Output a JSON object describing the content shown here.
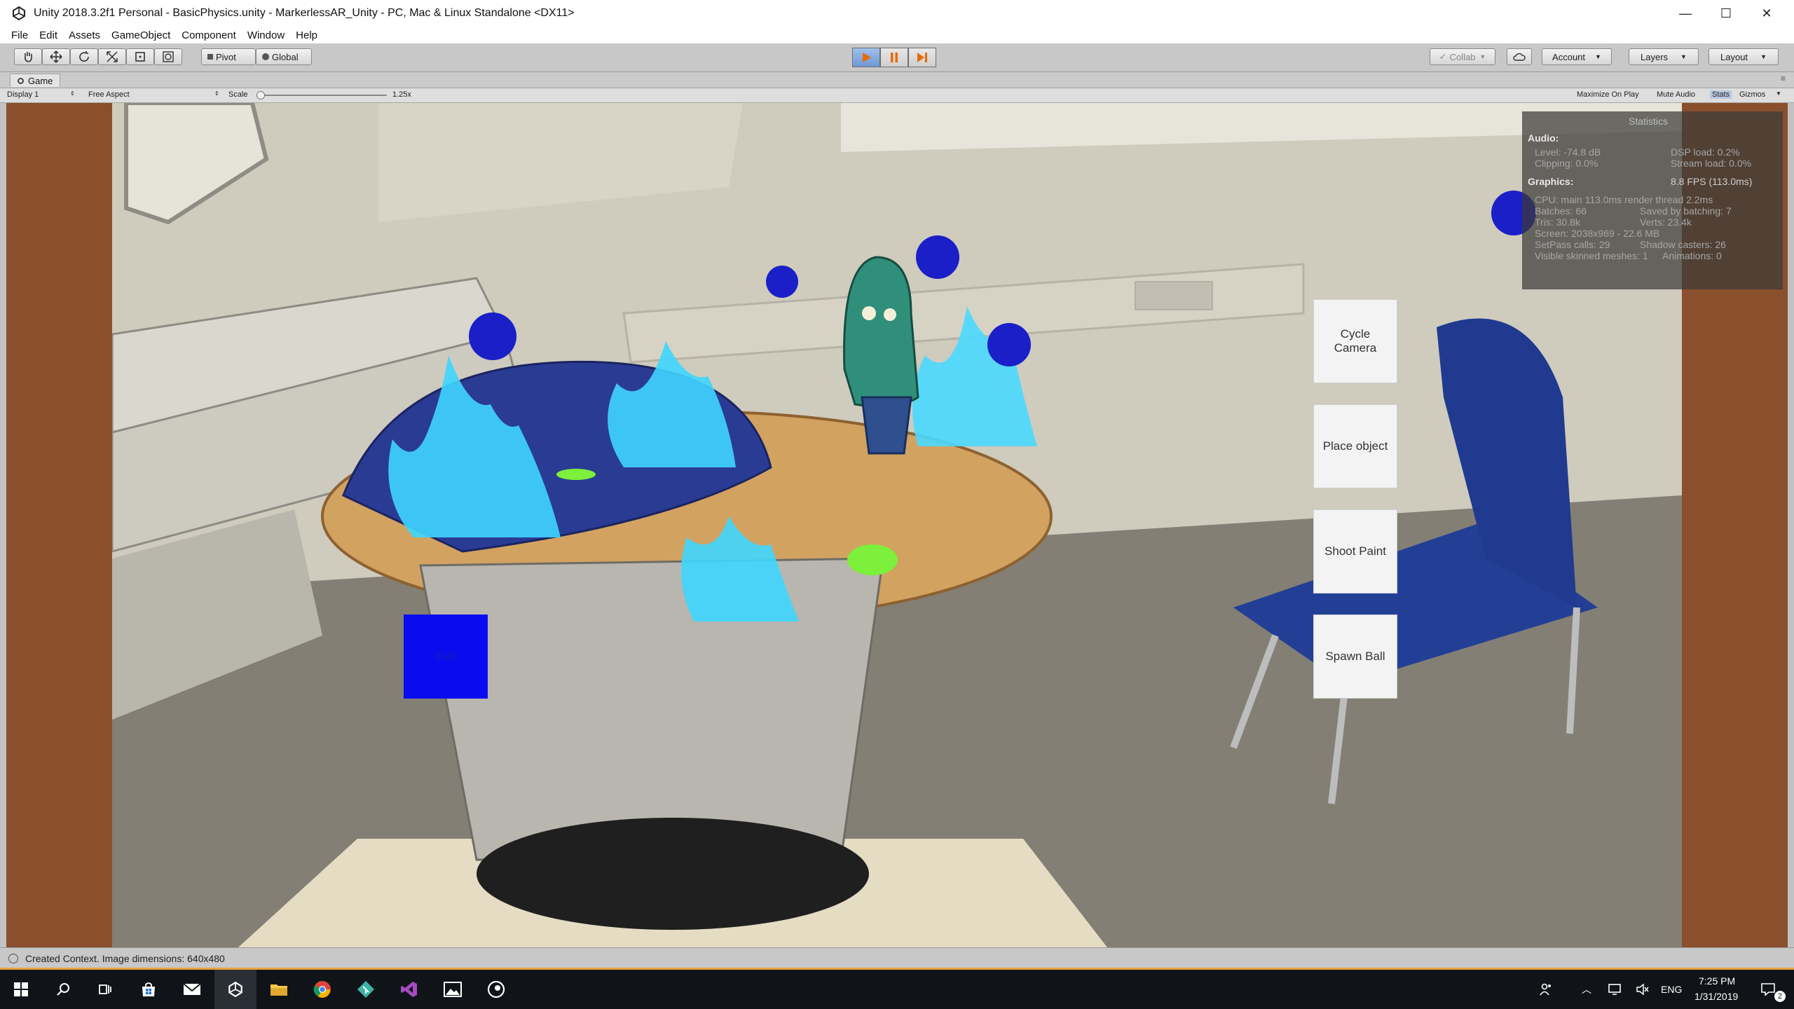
{
  "window": {
    "title": "Unity 2018.3.2f1 Personal - BasicPhysics.unity - MarkerlessAR_Unity - PC, Mac & Linux Standalone <DX11>",
    "minimize": "—",
    "maximize": "☐",
    "close": "✕"
  },
  "menu": [
    "File",
    "Edit",
    "Assets",
    "GameObject",
    "Component",
    "Window",
    "Help"
  ],
  "toolbar": {
    "pivot_label": "Pivot",
    "global_label": "Global",
    "collab_label": "Collab",
    "account_label": "Account",
    "layers_label": "Layers",
    "layout_label": "Layout"
  },
  "game_tab": {
    "tab_label": "Game",
    "display": "Display 1",
    "aspect": "Free Aspect",
    "scale_label": "Scale",
    "scale_value": "1.25x",
    "scale_fraction": 0.0,
    "maximize_on_play": "Maximize On Play",
    "mute_audio": "Mute Audio",
    "stats": "Stats",
    "gizmos": "Gizmos"
  },
  "game_ui": {
    "cycle_camera": "Cycle Camera",
    "place_object": "Place object",
    "shoot_paint": "Shoot Paint",
    "spawn_ball": "Spawn Ball",
    "exit": "Exit"
  },
  "statistics": {
    "header": "Statistics",
    "audio_label": "Audio:",
    "level": "Level: -74.8 dB",
    "clipping": "Clipping: 0.0%",
    "dsp_load": "DSP load: 0.2%",
    "stream_load": "Stream load: 0.0%",
    "graphics_label": "Graphics:",
    "fps": "8.8 FPS (113.0ms)",
    "cpu": "CPU: main 113.0ms  render thread 2.2ms",
    "batches": "Batches: 66",
    "saved_batching": "Saved by batching: 7",
    "tris": "Tris: 30.8k",
    "verts": "Verts: 23.4k",
    "screen": "Screen: 2038x969 - 22.6 MB",
    "setpass": "SetPass calls: 29",
    "shadow_casters": "Shadow casters: 26",
    "visible_skinned": "Visible skinned meshes: 1",
    "animations": "Animations: 0"
  },
  "status": {
    "message": "Created Context. Image dimensions: 640x480"
  },
  "taskbar": {
    "language": "ENG",
    "time": "7:25 PM",
    "date": "1/31/2019",
    "notification_count": "2"
  },
  "colors": {
    "accent_play": "#7aa6e0",
    "game_bg": "#8a4f2c",
    "ball_blue": "#1b1fc8",
    "fire_cyan": "#3fd6ff",
    "paint_green": "#7cf03a",
    "exit_blue": "#0a0cf0"
  }
}
